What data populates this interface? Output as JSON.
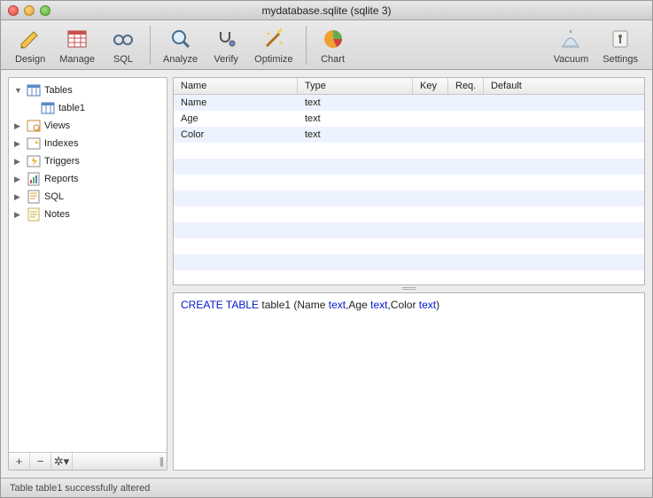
{
  "window": {
    "title": "mydatabase.sqlite (sqlite 3)"
  },
  "toolbar": {
    "design": "Design",
    "manage": "Manage",
    "sql": "SQL",
    "analyze": "Analyze",
    "verify": "Verify",
    "optimize": "Optimize",
    "chart": "Chart",
    "vacuum": "Vacuum",
    "settings": "Settings"
  },
  "sidebar": {
    "items": [
      {
        "label": "Tables",
        "expanded": true,
        "icon": "table",
        "children": [
          {
            "label": "table1",
            "icon": "table"
          }
        ]
      },
      {
        "label": "Views",
        "expanded": false,
        "icon": "view"
      },
      {
        "label": "Indexes",
        "expanded": false,
        "icon": "index"
      },
      {
        "label": "Triggers",
        "expanded": false,
        "icon": "trigger"
      },
      {
        "label": "Reports",
        "expanded": false,
        "icon": "report"
      },
      {
        "label": "SQL",
        "expanded": false,
        "icon": "sqlfile"
      },
      {
        "label": "Notes",
        "expanded": false,
        "icon": "notes"
      }
    ],
    "buttons": {
      "add": "+",
      "remove": "−",
      "gear": "✻"
    }
  },
  "grid": {
    "headers": {
      "name": "Name",
      "type": "Type",
      "key": "Key",
      "req": "Req.",
      "def": "Default"
    },
    "rows": [
      {
        "name": "Name",
        "type": "text",
        "key": "",
        "req": "",
        "def": ""
      },
      {
        "name": "Age",
        "type": "text",
        "key": "",
        "req": "",
        "def": ""
      },
      {
        "name": "Color",
        "type": "text",
        "key": "",
        "req": "",
        "def": ""
      }
    ]
  },
  "sqlpane": {
    "kw1": "CREATE TABLE",
    "tbl": " table1 (Name ",
    "t1": "text",
    "c1": ",Age ",
    "t2": "text",
    "c2": ",Color ",
    "t3": "text",
    "end": ")"
  },
  "status": {
    "text": "Table table1 successfully altered"
  }
}
